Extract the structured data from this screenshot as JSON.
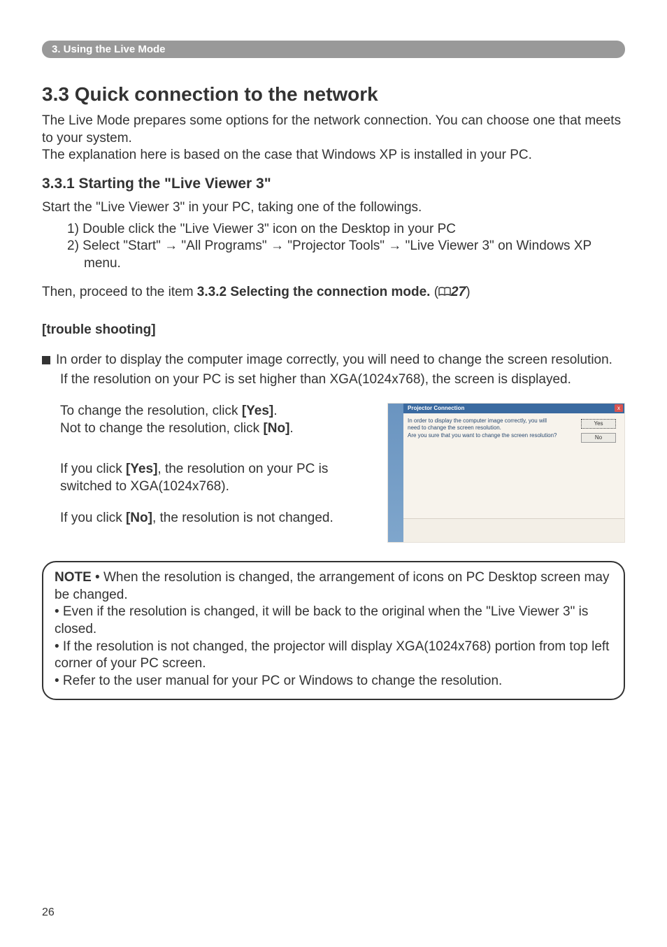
{
  "banner": {
    "text": "3. Using the Live Mode"
  },
  "h1": "3.3 Quick connection to the network",
  "intro1": "The Live Mode prepares some options for the network connection. You can choose one that meets to your system.",
  "intro2": "The explanation here is based on the case that Windows XP is installed in your PC.",
  "h2": "3.3.1 Starting the \"Live Viewer 3\"",
  "start_line": "Start the \"Live Viewer 3\" in your PC, taking one of the followings.",
  "list": {
    "i1": "1) Double click the \"Live Viewer 3\" icon on the Desktop in your PC",
    "i2": "2) Select \"Start\" → \"All Programs\" → \"Projector Tools\" → \"Live Viewer 3\" on Windows XP menu."
  },
  "proceed_pre": "Then, proceed to the item ",
  "proceed_bold": "3.3.2 Selecting the connection mode.",
  "proceed_open": " (",
  "proceed_ref": "27",
  "proceed_close": ")",
  "trouble_heading": "[trouble shooting]",
  "bullet1": "In order to display the computer image correctly, you will need to change the screen resolution.",
  "bullet1b": "If the resolution on your PC is set higher than XGA(1024x768), the screen is displayed.",
  "change_pre": "To change the resolution, click ",
  "change_yes": "[Yes]",
  "change_post": ".",
  "nochange_pre": "Not to change the resolution, click ",
  "nochange_no": "[No]",
  "nochange_post": ".",
  "yes_pre": "If you click ",
  "yes_bold": "[Yes]",
  "yes_post": ", the resolution on your PC is switched to XGA(1024x768).",
  "no_pre": "If you click ",
  "no_bold": "[No]",
  "no_post": ", the resolution is not changed.",
  "dialog": {
    "title": "Projector Connection",
    "close": "x",
    "line1": "In order to display the computer image correctly, you will",
    "line2": "need to change the screen resolution.",
    "line3": "Are you sure that you want to change the screen resolution?",
    "yes": "Yes",
    "no": "No"
  },
  "note": {
    "label": "NOTE",
    "n1": "  • When the resolution is changed, the arrangement of icons on PC Desktop screen may be changed.",
    "n2": "• Even if the resolution is changed, it will be back to the original when the \"Live Viewer 3\" is closed.",
    "n3": "• If the resolution is not changed, the projector will display XGA(1024x768) portion from top left corner of your PC screen.",
    "n4": "• Refer to the user manual for your PC or Windows to change the resolution."
  },
  "page_no": "26"
}
